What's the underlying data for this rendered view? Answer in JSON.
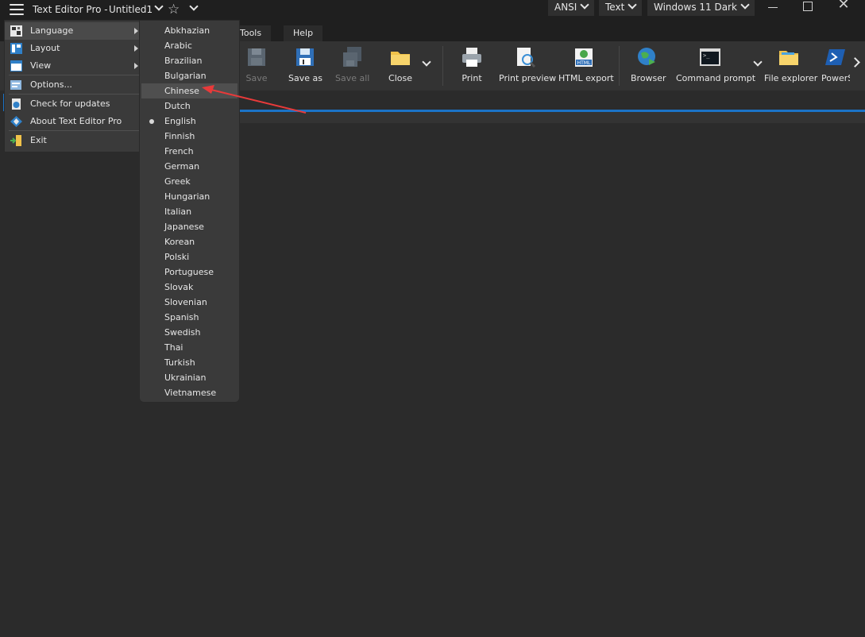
{
  "titlebar": {
    "app_title": "Text Editor Pro  -",
    "doc_title": "Untitled1",
    "encoding": "ANSI",
    "mode": "Text",
    "theme": "Windows 11 Dark"
  },
  "menu_tabs": [
    "Tools",
    "Help"
  ],
  "ribbon": {
    "save": "Save",
    "save_as": "Save as",
    "save_all": "Save all",
    "close": "Close",
    "print": "Print",
    "print_preview": "Print preview",
    "html_export": "HTML export",
    "browser": "Browser",
    "command_prompt": "Command prompt",
    "file_explorer": "File explorer",
    "powershell": "PowerS"
  },
  "main_menu": {
    "language": "Language",
    "layout": "Layout",
    "view": "View",
    "options": "Options...",
    "check_updates": "Check for updates",
    "about": "About Text Editor Pro",
    "exit": "Exit"
  },
  "languages": [
    "Abkhazian",
    "Arabic",
    "Brazilian",
    "Bulgarian",
    "Chinese",
    "Dutch",
    "English",
    "Finnish",
    "French",
    "German",
    "Greek",
    "Hungarian",
    "Italian",
    "Japanese",
    "Korean",
    "Polski",
    "Portuguese",
    "Slovak",
    "Slovenian",
    "Spanish",
    "Swedish",
    "Thai",
    "Turkish",
    "Ukrainian",
    "Vietnamese"
  ],
  "highlighted_language": "Chinese",
  "current_language": "English",
  "colors": {
    "accent": "#1b73c6",
    "annotation_arrow": "#e83a3a"
  }
}
